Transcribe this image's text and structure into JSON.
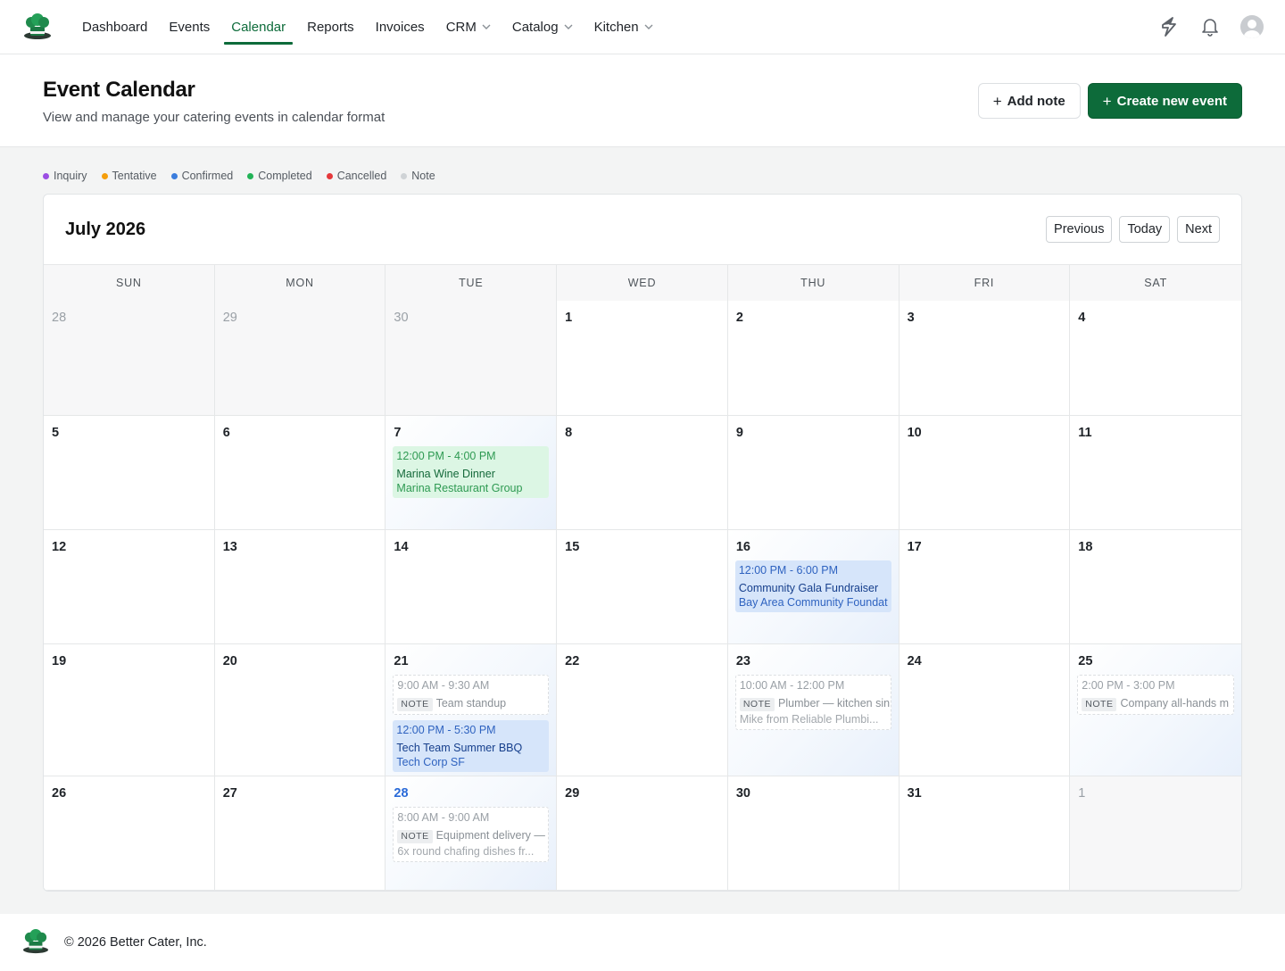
{
  "nav": {
    "items": [
      {
        "label": "Dashboard",
        "active": false,
        "dropdown": false
      },
      {
        "label": "Events",
        "active": false,
        "dropdown": false
      },
      {
        "label": "Calendar",
        "active": true,
        "dropdown": false
      },
      {
        "label": "Reports",
        "active": false,
        "dropdown": false
      },
      {
        "label": "Invoices",
        "active": false,
        "dropdown": false
      },
      {
        "label": "CRM",
        "active": false,
        "dropdown": true
      },
      {
        "label": "Catalog",
        "active": false,
        "dropdown": true
      },
      {
        "label": "Kitchen",
        "active": false,
        "dropdown": true
      }
    ],
    "icons": [
      "chef-hat-logo-icon",
      "lightning-icon",
      "bell-icon",
      "user-avatar-icon"
    ]
  },
  "header": {
    "title": "Event Calendar",
    "subtitle": "View and manage your catering events in calendar format",
    "add_note_label": "Add note",
    "create_event_label": "Create new event"
  },
  "legend": [
    {
      "label": "Inquiry",
      "color": "#9b4ee3"
    },
    {
      "label": "Tentative",
      "color": "#f59e0b"
    },
    {
      "label": "Confirmed",
      "color": "#3b7ddd"
    },
    {
      "label": "Completed",
      "color": "#22b357"
    },
    {
      "label": "Cancelled",
      "color": "#e5383b"
    },
    {
      "label": "Note",
      "color": "#cfd3d6"
    }
  ],
  "calendar": {
    "month_label": "July 2026",
    "previous_label": "Previous",
    "today_label": "Today",
    "next_label": "Next",
    "weekdays": [
      "SUN",
      "MON",
      "TUE",
      "WED",
      "THU",
      "FRI",
      "SAT"
    ],
    "weeks": [
      [
        {
          "day": "28",
          "outside": true
        },
        {
          "day": "29",
          "outside": true
        },
        {
          "day": "30",
          "outside": true
        },
        {
          "day": "1"
        },
        {
          "day": "2"
        },
        {
          "day": "3"
        },
        {
          "day": "4"
        }
      ],
      [
        {
          "day": "5"
        },
        {
          "day": "6"
        },
        {
          "day": "7",
          "events": [
            {
              "kind": "green",
              "time": "12:00 PM - 4:00 PM",
              "name": "Marina Wine Dinner",
              "client": "Marina Restaurant Group"
            }
          ]
        },
        {
          "day": "8"
        },
        {
          "day": "9"
        },
        {
          "day": "10"
        },
        {
          "day": "11"
        }
      ],
      [
        {
          "day": "12"
        },
        {
          "day": "13"
        },
        {
          "day": "14"
        },
        {
          "day": "15"
        },
        {
          "day": "16",
          "events": [
            {
              "kind": "blue",
              "time": "12:00 PM - 6:00 PM",
              "name": "Community Gala Fundraiser",
              "client": "Bay Area Community Foundat"
            }
          ]
        },
        {
          "day": "17"
        },
        {
          "day": "18"
        }
      ],
      [
        {
          "day": "19"
        },
        {
          "day": "20"
        },
        {
          "day": "21",
          "events": [
            {
              "kind": "note",
              "time": "9:00 AM - 9:30 AM",
              "tag": "NOTE",
              "text": "Team standup"
            },
            {
              "kind": "blue",
              "time": "12:00 PM - 5:30 PM",
              "name": "Tech Team Summer BBQ",
              "client": "Tech Corp SF"
            }
          ]
        },
        {
          "day": "22"
        },
        {
          "day": "23",
          "events": [
            {
              "kind": "note",
              "time": "10:00 AM - 12:00 PM",
              "tag": "NOTE",
              "text": "Plumber — kitchen sin",
              "detail": "Mike from Reliable Plumbi..."
            }
          ]
        },
        {
          "day": "24"
        },
        {
          "day": "25",
          "events": [
            {
              "kind": "note",
              "time": "2:00 PM - 3:00 PM",
              "tag": "NOTE",
              "text": "Company all-hands m"
            }
          ]
        }
      ],
      [
        {
          "day": "26"
        },
        {
          "day": "27"
        },
        {
          "day": "28",
          "today": true,
          "events": [
            {
              "kind": "note",
              "time": "8:00 AM - 9:00 AM",
              "tag": "NOTE",
              "text": "Equipment delivery —",
              "detail": "6x round chafing dishes fr..."
            }
          ]
        },
        {
          "day": "29"
        },
        {
          "day": "30"
        },
        {
          "day": "31"
        },
        {
          "day": "1",
          "outside": true
        }
      ]
    ]
  },
  "footer": {
    "text": "© 2026 Better Cater, Inc."
  }
}
